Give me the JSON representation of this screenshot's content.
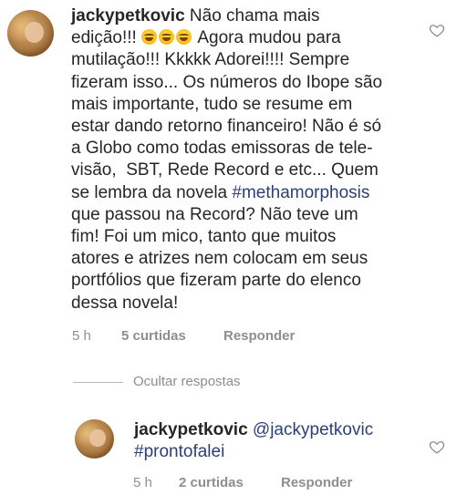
{
  "main_comment": {
    "username": "jackypetkovic",
    "line1_text": " Não chama mais",
    "line2_text": "edição!!! ",
    "line2_after_emoji": " Agora mudou para",
    "emoji_icon": "tears-of-joy-emoji",
    "lines": [
      "mutilação!!! Kkkkk Adorei!!!! Sempre",
      "fizeram isso... Os números do Ibope são",
      "mais importante, tudo se resume em",
      "estar dando retorno financeiro! Não é só",
      "a Globo como todas emissoras de tele-",
      "visão,  SBT, Rede Record e etc... Quem",
      "se lembra da novela "
    ],
    "hashtag": "#methamorphosis",
    "lines_after": [
      "que passou na Record? Não teve um",
      "fim! Foi um mico, tanto que muitos",
      "atores e atrizes nem colocam em seus",
      "portfólios que fizeram parte do elenco",
      "dessa novela!"
    ],
    "time": "5 h",
    "likes": "5 curtidas",
    "reply_label": "Responder"
  },
  "hide_replies": "Ocultar respostas",
  "reply_comment": {
    "username": "jackypetkovic",
    "mention": "@jackypetkovic",
    "hashtag": "#prontofalei",
    "time": "5 h",
    "likes": "2 curtidas",
    "reply_label": "Responder"
  }
}
